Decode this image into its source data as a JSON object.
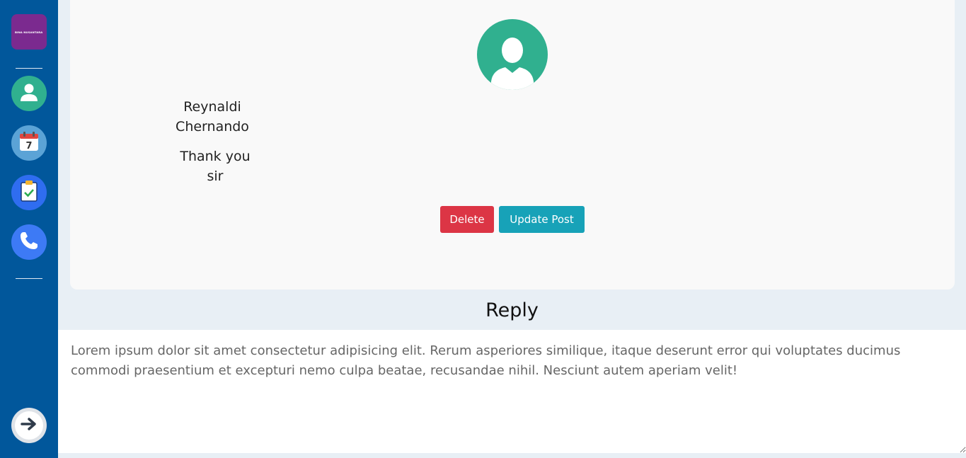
{
  "sidebar": {
    "logo_text": "BINA NUSANTARA",
    "items": [
      {
        "name": "profile",
        "icon": "user-icon",
        "color": "#30b08f"
      },
      {
        "name": "calendar",
        "icon": "calendar-icon",
        "day": "7",
        "color": "#5ba3d6"
      },
      {
        "name": "tasks",
        "icon": "clipboard-icon",
        "color": "#2f6df0"
      },
      {
        "name": "contact",
        "icon": "phone-icon",
        "color": "#3d7af5"
      }
    ],
    "exit_icon": "arrow-right-icon"
  },
  "post": {
    "author": "Reynaldi Chernando",
    "body": "Thank you sir",
    "delete_label": "Delete",
    "update_label": "Update Post"
  },
  "reply": {
    "title": "Reply",
    "text": "Lorem ipsum dolor sit amet consectetur adipisicing elit. Rerum asperiores similique, itaque deserunt error qui voluptates ducimus commodi praesentium et excepturi nemo culpa beatae, recusandae nihil. Nesciunt autem aperiam velit!"
  },
  "colors": {
    "sidebar": "#01579b",
    "delete": "#dc3545",
    "update": "#17a2b8",
    "avatar": "#30b08f"
  }
}
